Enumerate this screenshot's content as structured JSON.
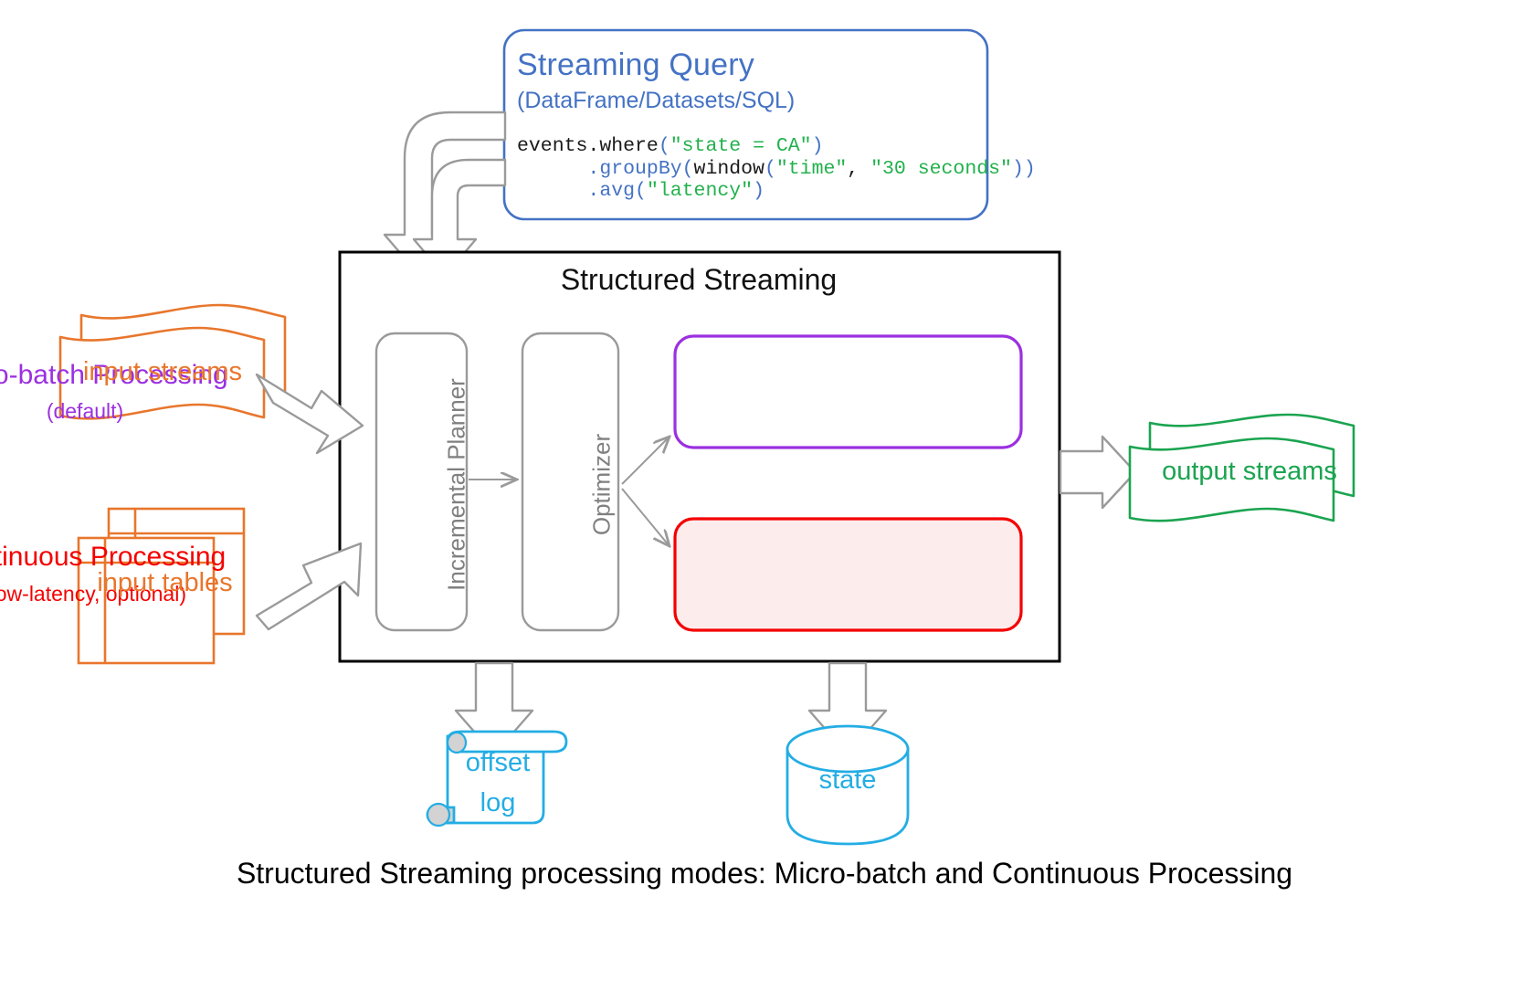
{
  "diagram": {
    "caption": "Structured Streaming processing modes: Micro-batch and Continuous Processing",
    "container": {
      "title": "Structured Streaming"
    },
    "query_card": {
      "title": "Streaming Query",
      "subtitle": "(DataFrame/Datasets/SQL)",
      "code_lines": [
        {
          "parts": [
            {
              "t": "events",
              "c": "plain"
            },
            {
              "t": ".where",
              "c": "plain"
            },
            {
              "t": "(",
              "c": "paren"
            },
            {
              "t": "\"state = CA\"",
              "c": "string"
            },
            {
              "t": ")",
              "c": "paren"
            }
          ]
        },
        {
          "parts": [
            {
              "t": "      ",
              "c": "plain"
            },
            {
              "t": ".groupBy",
              "c": "paren"
            },
            {
              "t": "(",
              "c": "paren"
            },
            {
              "t": "window",
              "c": "plain"
            },
            {
              "t": "(",
              "c": "paren"
            },
            {
              "t": "\"time\"",
              "c": "string"
            },
            {
              "t": ", ",
              "c": "plain"
            },
            {
              "t": "\"30 seconds\"",
              "c": "string"
            },
            {
              "t": "))",
              "c": "paren"
            }
          ]
        },
        {
          "parts": [
            {
              "t": "      ",
              "c": "plain"
            },
            {
              "t": ".avg",
              "c": "paren"
            },
            {
              "t": "(",
              "c": "paren"
            },
            {
              "t": "\"latency\"",
              "c": "string"
            },
            {
              "t": ")",
              "c": "paren"
            }
          ]
        }
      ]
    },
    "stages": [
      {
        "label": "Incremental Planner"
      },
      {
        "label": "Optimizer"
      }
    ],
    "modes": [
      {
        "title": "Micro-batch Processing",
        "subtitle": "(default)",
        "color": "#9b30e0",
        "fill": "#ffffff"
      },
      {
        "title": "Continuous Processing",
        "subtitle": "(low-latency, optional)",
        "color": "#f40000",
        "fill": "#fdecec"
      }
    ],
    "inputs": [
      {
        "label": "input streams",
        "icon": "stream-ribbon-icon",
        "color": "#e8762c"
      },
      {
        "label": "input tables",
        "icon": "table-stack-icon",
        "color": "#e8762c"
      }
    ],
    "outputs": [
      {
        "label": "output streams",
        "icon": "stream-ribbon-icon",
        "color": "#1ba450"
      }
    ],
    "stores": [
      {
        "label": "offset log",
        "icon": "scroll-document-icon",
        "color": "#24ade4"
      },
      {
        "label": "state",
        "icon": "database-cylinder-icon",
        "color": "#24ade4"
      }
    ],
    "colors": {
      "query_blue": "#4472c4",
      "code_string_green": "#22b14c",
      "orange": "#e8762c",
      "green": "#1ba450",
      "cyan": "#24ade4",
      "purple": "#9b30e0",
      "red": "#f40000",
      "arrow_gray": "#9a9a9a",
      "container_black": "#000000"
    }
  }
}
